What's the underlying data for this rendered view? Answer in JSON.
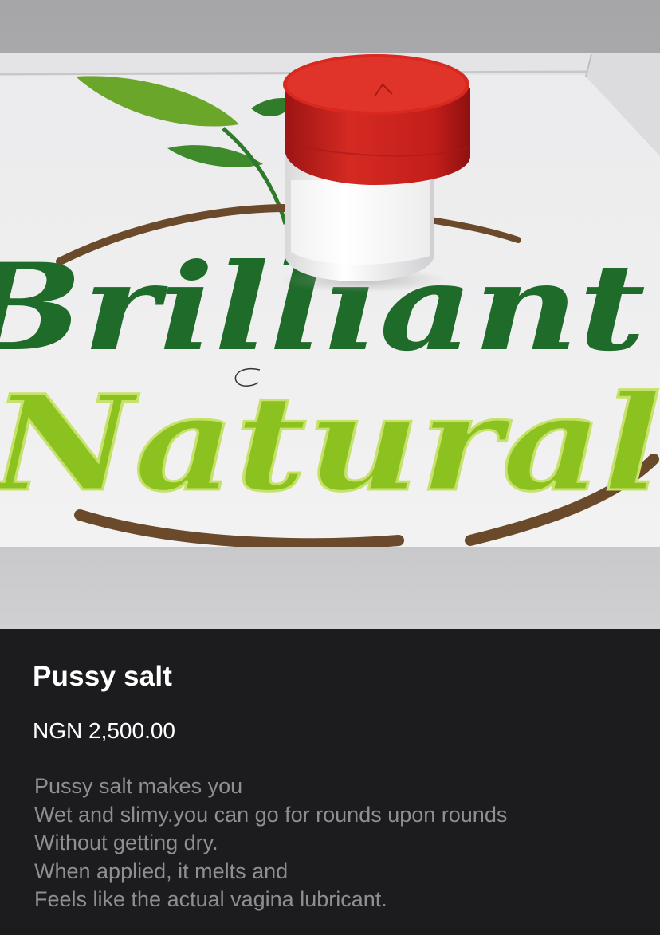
{
  "gallery": {
    "image_logo_text": [
      "Brilliant",
      "Natural"
    ],
    "image_description": "Small clear jar with red screw cap containing white salt granules placed on a printed Brilliant Natural logo",
    "colors": {
      "cap": "#c8201f",
      "logo_dark_green": "#1f6b2a",
      "logo_light_green": "#8cc21f",
      "swoosh_brown": "#6b4a2b"
    }
  },
  "product": {
    "title": "Pussy salt",
    "price": "NGN 2,500.00",
    "description": [
      "Pussy salt makes you",
      "Wet and slimy.you can go for rounds upon rounds",
      "Without getting dry.",
      "When applied, it melts and",
      "Feels like the actual vagina lubricant."
    ]
  }
}
